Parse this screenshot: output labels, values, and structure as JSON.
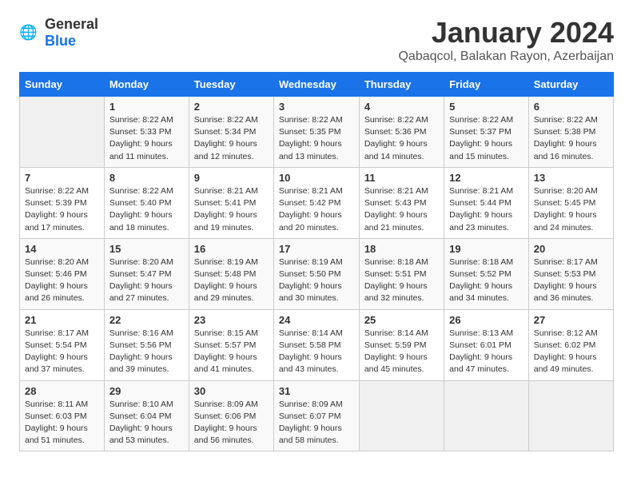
{
  "header": {
    "logo_general": "General",
    "logo_blue": "Blue",
    "month": "January 2024",
    "location": "Qabaqcol, Balakan Rayon, Azerbaijan"
  },
  "days_of_week": [
    "Sunday",
    "Monday",
    "Tuesday",
    "Wednesday",
    "Thursday",
    "Friday",
    "Saturday"
  ],
  "weeks": [
    [
      {
        "day": "",
        "info": ""
      },
      {
        "day": "1",
        "info": "Sunrise: 8:22 AM\nSunset: 5:33 PM\nDaylight: 9 hours\nand 11 minutes."
      },
      {
        "day": "2",
        "info": "Sunrise: 8:22 AM\nSunset: 5:34 PM\nDaylight: 9 hours\nand 12 minutes."
      },
      {
        "day": "3",
        "info": "Sunrise: 8:22 AM\nSunset: 5:35 PM\nDaylight: 9 hours\nand 13 minutes."
      },
      {
        "day": "4",
        "info": "Sunrise: 8:22 AM\nSunset: 5:36 PM\nDaylight: 9 hours\nand 14 minutes."
      },
      {
        "day": "5",
        "info": "Sunrise: 8:22 AM\nSunset: 5:37 PM\nDaylight: 9 hours\nand 15 minutes."
      },
      {
        "day": "6",
        "info": "Sunrise: 8:22 AM\nSunset: 5:38 PM\nDaylight: 9 hours\nand 16 minutes."
      }
    ],
    [
      {
        "day": "7",
        "info": "Sunrise: 8:22 AM\nSunset: 5:39 PM\nDaylight: 9 hours\nand 17 minutes."
      },
      {
        "day": "8",
        "info": "Sunrise: 8:22 AM\nSunset: 5:40 PM\nDaylight: 9 hours\nand 18 minutes."
      },
      {
        "day": "9",
        "info": "Sunrise: 8:21 AM\nSunset: 5:41 PM\nDaylight: 9 hours\nand 19 minutes."
      },
      {
        "day": "10",
        "info": "Sunrise: 8:21 AM\nSunset: 5:42 PM\nDaylight: 9 hours\nand 20 minutes."
      },
      {
        "day": "11",
        "info": "Sunrise: 8:21 AM\nSunset: 5:43 PM\nDaylight: 9 hours\nand 21 minutes."
      },
      {
        "day": "12",
        "info": "Sunrise: 8:21 AM\nSunset: 5:44 PM\nDaylight: 9 hours\nand 23 minutes."
      },
      {
        "day": "13",
        "info": "Sunrise: 8:20 AM\nSunset: 5:45 PM\nDaylight: 9 hours\nand 24 minutes."
      }
    ],
    [
      {
        "day": "14",
        "info": "Sunrise: 8:20 AM\nSunset: 5:46 PM\nDaylight: 9 hours\nand 26 minutes."
      },
      {
        "day": "15",
        "info": "Sunrise: 8:20 AM\nSunset: 5:47 PM\nDaylight: 9 hours\nand 27 minutes."
      },
      {
        "day": "16",
        "info": "Sunrise: 8:19 AM\nSunset: 5:48 PM\nDaylight: 9 hours\nand 29 minutes."
      },
      {
        "day": "17",
        "info": "Sunrise: 8:19 AM\nSunset: 5:50 PM\nDaylight: 9 hours\nand 30 minutes."
      },
      {
        "day": "18",
        "info": "Sunrise: 8:18 AM\nSunset: 5:51 PM\nDaylight: 9 hours\nand 32 minutes."
      },
      {
        "day": "19",
        "info": "Sunrise: 8:18 AM\nSunset: 5:52 PM\nDaylight: 9 hours\nand 34 minutes."
      },
      {
        "day": "20",
        "info": "Sunrise: 8:17 AM\nSunset: 5:53 PM\nDaylight: 9 hours\nand 36 minutes."
      }
    ],
    [
      {
        "day": "21",
        "info": "Sunrise: 8:17 AM\nSunset: 5:54 PM\nDaylight: 9 hours\nand 37 minutes."
      },
      {
        "day": "22",
        "info": "Sunrise: 8:16 AM\nSunset: 5:56 PM\nDaylight: 9 hours\nand 39 minutes."
      },
      {
        "day": "23",
        "info": "Sunrise: 8:15 AM\nSunset: 5:57 PM\nDaylight: 9 hours\nand 41 minutes."
      },
      {
        "day": "24",
        "info": "Sunrise: 8:14 AM\nSunset: 5:58 PM\nDaylight: 9 hours\nand 43 minutes."
      },
      {
        "day": "25",
        "info": "Sunrise: 8:14 AM\nSunset: 5:59 PM\nDaylight: 9 hours\nand 45 minutes."
      },
      {
        "day": "26",
        "info": "Sunrise: 8:13 AM\nSunset: 6:01 PM\nDaylight: 9 hours\nand 47 minutes."
      },
      {
        "day": "27",
        "info": "Sunrise: 8:12 AM\nSunset: 6:02 PM\nDaylight: 9 hours\nand 49 minutes."
      }
    ],
    [
      {
        "day": "28",
        "info": "Sunrise: 8:11 AM\nSunset: 6:03 PM\nDaylight: 9 hours\nand 51 minutes."
      },
      {
        "day": "29",
        "info": "Sunrise: 8:10 AM\nSunset: 6:04 PM\nDaylight: 9 hours\nand 53 minutes."
      },
      {
        "day": "30",
        "info": "Sunrise: 8:09 AM\nSunset: 6:06 PM\nDaylight: 9 hours\nand 56 minutes."
      },
      {
        "day": "31",
        "info": "Sunrise: 8:09 AM\nSunset: 6:07 PM\nDaylight: 9 hours\nand 58 minutes."
      },
      {
        "day": "",
        "info": ""
      },
      {
        "day": "",
        "info": ""
      },
      {
        "day": "",
        "info": ""
      }
    ]
  ]
}
